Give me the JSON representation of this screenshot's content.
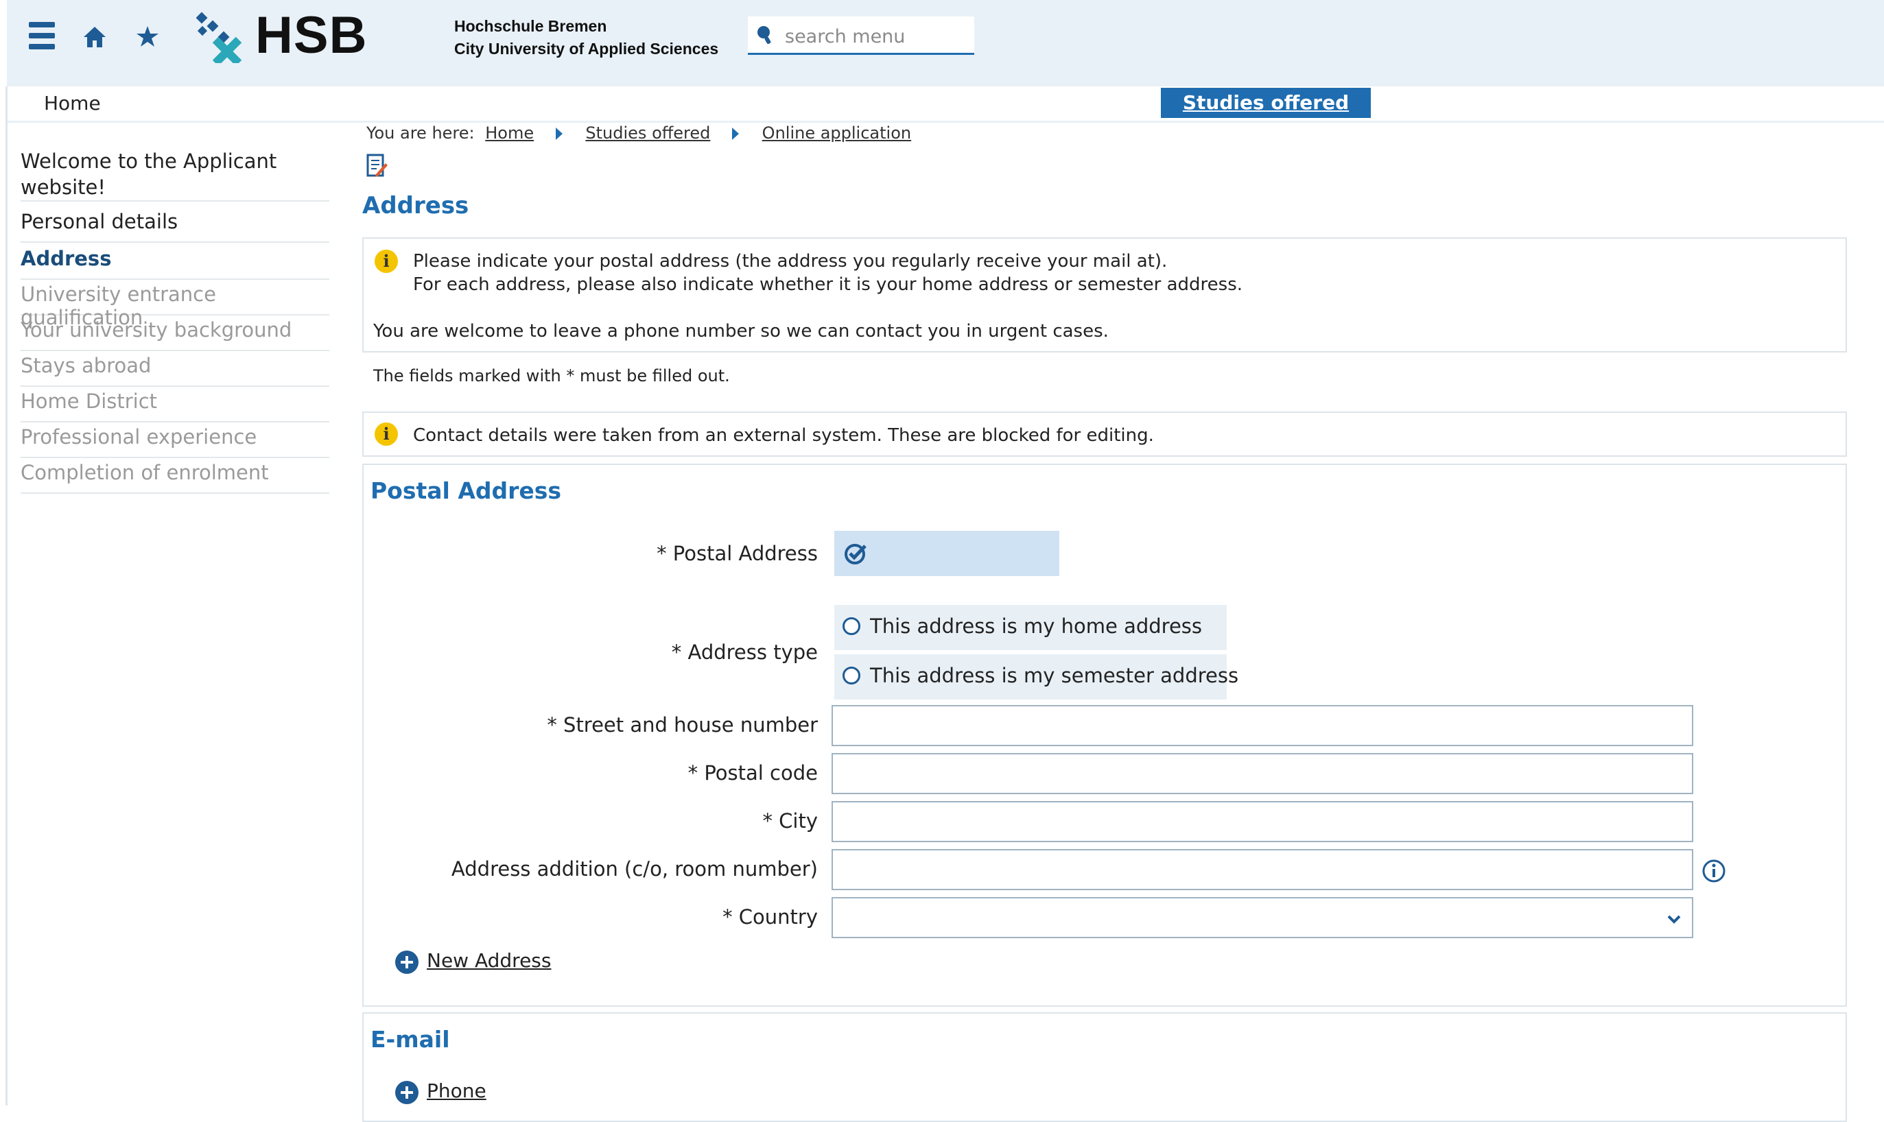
{
  "header": {
    "logo_text": "HSB",
    "university_line1": "Hochschule Bremen",
    "university_line2": "City University of Applied Sciences",
    "search_placeholder": "search menu",
    "icons": [
      "menu-icon",
      "home-icon",
      "star-icon",
      "search-icon"
    ],
    "accent_color": "#1f6db0"
  },
  "nav": {
    "home_label": "Home",
    "studies_label": "Studies offered"
  },
  "sidebar": {
    "items": [
      {
        "label": "Welcome to the Applicant website!",
        "state": "normal"
      },
      {
        "label": "Personal details",
        "state": "normal"
      },
      {
        "label": "Address",
        "state": "active"
      },
      {
        "label": "University entrance qualification",
        "state": "disabled"
      },
      {
        "label": "Your university background",
        "state": "disabled"
      },
      {
        "label": "Stays abroad",
        "state": "disabled"
      },
      {
        "label": "Home District",
        "state": "disabled"
      },
      {
        "label": "Professional experience",
        "state": "disabled"
      },
      {
        "label": "Completion of enrolment",
        "state": "disabled"
      }
    ]
  },
  "breadcrumb": {
    "prefix": "You are here:",
    "items": [
      "Home",
      "Studies offered",
      "Online application"
    ]
  },
  "page": {
    "title": "Address",
    "info_line1": "Please indicate your postal address (the address you regularly receive your mail at).",
    "info_line2": "For each address, please also indicate whether it is your home address or semester address.",
    "info_line3": "You are welcome to leave a phone number so we can contact you in urgent cases.",
    "required_note": "The fields marked with * must be filled out.",
    "contact_note": "Contact details were taken from an external system. These are blocked for editing."
  },
  "postal": {
    "section_title": "Postal Address",
    "postal_address_label": "* Postal Address",
    "address_type_label": "* Address type",
    "radio_home": "This address is my home address",
    "radio_semester": "This address is my semester address",
    "street_label": "* Street and house number",
    "street_value": "",
    "postal_code_label": "* Postal code",
    "postal_code_value": "",
    "city_label": "* City",
    "city_value": "",
    "addition_label": "Address addition (c/o, room number)",
    "addition_value": "",
    "country_label": "* Country",
    "country_value": "",
    "new_address_label": "New Address"
  },
  "email": {
    "section_title": "E-mail",
    "phone_label": "Phone"
  }
}
